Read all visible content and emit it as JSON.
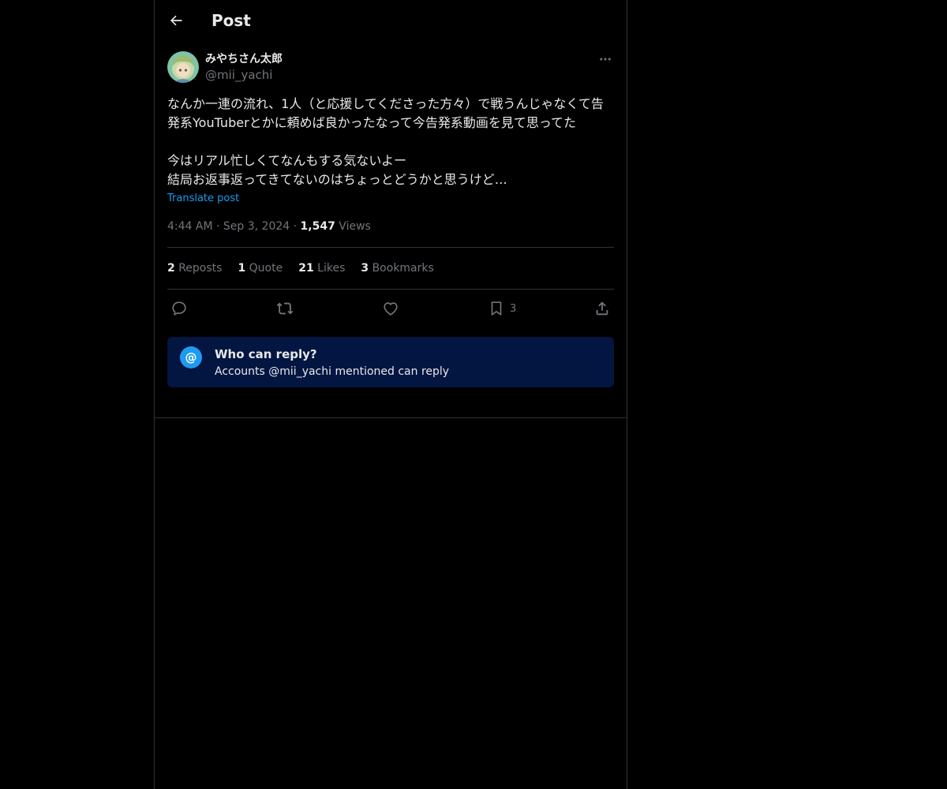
{
  "header": {
    "title": "Post",
    "back_icon": "arrow-left-icon"
  },
  "post": {
    "author": {
      "display_name": "みやちさん太郎",
      "handle": "@mii_yachi",
      "avatar_icon": "avatar-anime-girl"
    },
    "more_icon": "more-dots-icon",
    "text": "なんか一連の流れ、1人（と応援してくださった方々）で戦うんじゃなくて告発系YouTuberとかに頼めば良かったなって今告発系動画を見て思ってた\n\n今はリアル忙しくてなんもする気ないよー\n結局お返事返ってきてないのはちょっとどうかと思うけど…",
    "translate_label": "Translate post",
    "time": "4:44 AM",
    "date": "Sep 3, 2024",
    "views_count": "1,547",
    "views_label": "Views",
    "separator": "·"
  },
  "stats": {
    "reposts_count": "2",
    "reposts_label": "Reposts",
    "quotes_count": "1",
    "quotes_label": "Quote",
    "likes_count": "21",
    "likes_label": "Likes",
    "bookmarks_count": "3",
    "bookmarks_label": "Bookmarks"
  },
  "actions": {
    "reply_icon": "reply-bubble-icon",
    "repost_icon": "repost-icon",
    "like_icon": "heart-icon",
    "bookmark_icon": "bookmark-icon",
    "bookmark_count": "3",
    "share_icon": "share-icon"
  },
  "reply_restriction": {
    "icon_glyph": "@",
    "title": "Who can reply?",
    "subtitle": "Accounts @mii_yachi mentioned can reply"
  },
  "colors": {
    "background": "#000000",
    "text": "#e7e9ea",
    "muted": "#71767b",
    "accent": "#1d9bf0",
    "border": "#2f3336",
    "reply_box": "#031541"
  }
}
